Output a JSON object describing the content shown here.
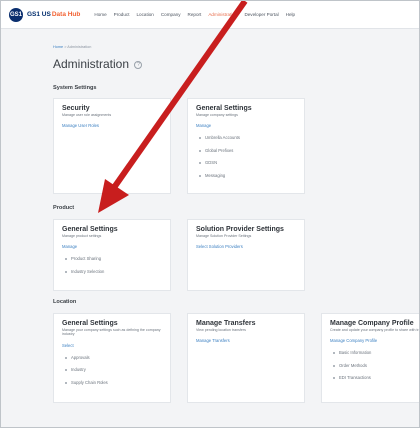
{
  "header": {
    "logo_text": "GS1",
    "brand": "GS1 US",
    "brand_accent": "Data Hub",
    "nav": [
      "Home",
      "Product",
      "Location",
      "Company",
      "Report",
      "Administration",
      "Developer Portal",
      "Help"
    ],
    "active_nav": "Administration"
  },
  "breadcrumb": {
    "home": "Home",
    "separator": ">",
    "current": "Administration"
  },
  "page": {
    "title": "Administration",
    "help_icon": "question-circle-icon"
  },
  "sections": {
    "system": {
      "title": "System Settings",
      "cards": [
        {
          "title": "Security",
          "desc": "Manage user role assignments",
          "link": "Manage User Roles",
          "items": []
        },
        {
          "title": "General Settings",
          "desc": "Manage company settings",
          "link": "Manage",
          "items": [
            "Umbrella Accounts",
            "Global Prefixes",
            "GDSN",
            "Messaging"
          ]
        }
      ]
    },
    "product": {
      "title": "Product",
      "cards": [
        {
          "title": "General Settings",
          "desc": "Manage product settings",
          "link": "Manage",
          "items": [
            "Product Sharing",
            "Industry Selection"
          ]
        },
        {
          "title": "Solution Provider Settings",
          "desc": "Manage Solution Provider Settings",
          "link": "Select Solution Providers",
          "items": []
        }
      ]
    },
    "location": {
      "title": "Location",
      "cards": [
        {
          "title": "General Settings",
          "desc": "Manage your company settings such as defining the company industry",
          "link": "Select",
          "items": [
            "Approvals",
            "Industry",
            "Supply Chain Roles"
          ]
        },
        {
          "title": "Manage Transfers",
          "desc": "View pending location transfers",
          "link": "Manage Transfers",
          "items": []
        },
        {
          "title": "Manage Company Profile",
          "desc": "Create and update your company profile to share with trading partners",
          "link": "Manage Company Profile",
          "items": [
            "Basic Information",
            "Order Methods",
            "EDI Transactions"
          ]
        }
      ]
    }
  },
  "colors": {
    "accent": "#3a7fc1",
    "brand": "#002c6c",
    "brand_orange": "#f26334",
    "annotation_arrow": "#c81e1e"
  }
}
